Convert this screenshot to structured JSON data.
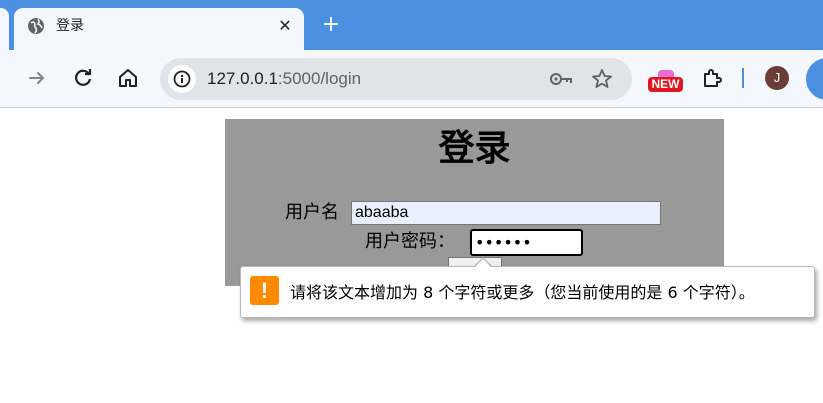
{
  "browser": {
    "tab": {
      "title": "登录",
      "favicon": "globe-icon",
      "close": "✕"
    },
    "new_tab": "+",
    "address_bar": {
      "host": "127.0.0.1",
      "path": ":5000/login"
    },
    "new_badge": "NEW",
    "profile_initial": "J",
    "colors": {
      "frame": "#4a8fe0",
      "toolbar": "#f4f7fd",
      "omnibox": "#dfe3ea"
    }
  },
  "login": {
    "title": "登录",
    "username_label": "用户名",
    "username_value": "abaaba",
    "password_label": "用户密码：",
    "password_value": "••••••",
    "box_color": "#999999"
  },
  "validation": {
    "icon": "warning-icon",
    "message": "请将该文本增加为 8 个字符或更多（您当前使用的是 6 个字符）。",
    "icon_color": "#ff8a00"
  }
}
